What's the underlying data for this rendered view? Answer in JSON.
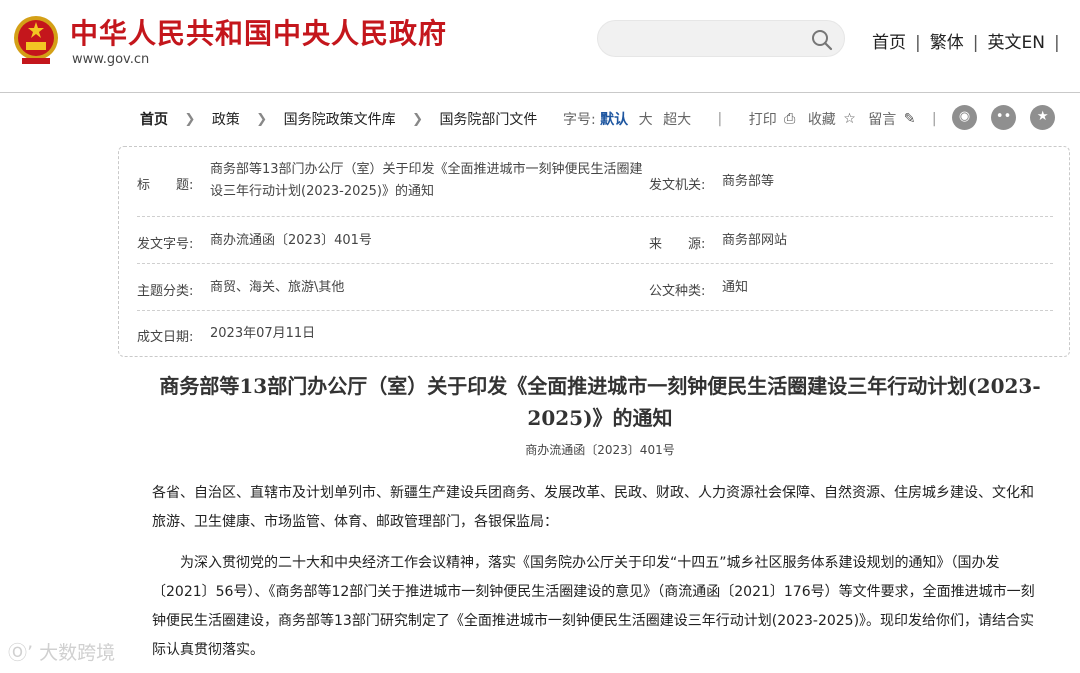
{
  "header": {
    "site_title": "中华人民共和国中央人民政府",
    "site_url": "www.gov.cn",
    "search_placeholder": "",
    "links": [
      "首页",
      "繁体",
      "英文EN"
    ],
    "separator": "|"
  },
  "breadcrumb": [
    "首页",
    "政策",
    "国务院政策文件库",
    "国务院部门文件"
  ],
  "toolbar": {
    "font_size_label": "字号:",
    "font_default": "默认",
    "font_large": "大",
    "font_xlarge": "超大",
    "print_label": "打印",
    "favorite_label": "收藏",
    "comment_label": "留言"
  },
  "share_icons": [
    "weibo-icon",
    "wechat-icon",
    "star-icon"
  ],
  "info": {
    "title_label": "标　　题:",
    "title_value": "商务部等13部门办公厅（室）关于印发《全面推进城市一刻钟便民生活圈建设三年行动计划(2023-2025)》的通知",
    "issuer_label": "发文机关:",
    "issuer_value": "商务部等",
    "doc_no_label": "发文字号:",
    "doc_no_value": "商办流通函〔2023〕401号",
    "source_label": "来　　源:",
    "source_value": "商务部网站",
    "topic_label": "主题分类:",
    "topic_value": "商贸、海关、旅游\\其他",
    "type_label": "公文种类:",
    "type_value": "通知",
    "date_label": "成文日期:",
    "date_value": "2023年07月11日"
  },
  "article": {
    "title": "商务部等13部门办公厅（室）关于印发《全面推进城市一刻钟便民生活圈建设三年行动计划(2023-2025)》的通知",
    "number": "商办流通函〔2023〕401号",
    "addressees": "各省、自治区、直辖市及计划单列市、新疆生产建设兵团商务、发展改革、民政、财政、人力资源社会保障、自然资源、住房城乡建设、文化和旅游、卫生健康、市场监管、体育、邮政管理部门，各银保监局：",
    "body": "为深入贯彻党的二十大和中央经济工作会议精神，落实《国务院办公厅关于印发“十四五”城乡社区服务体系建设规划的通知》（国办发〔2021〕56号）、《商务部等12部门关于推进城市一刻钟便民生活圈建设的意见》（商流通函〔2021〕176号）等文件要求，全面推进城市一刻钟便民生活圈建设，商务部等13部门研究制定了《全面推进城市一刻钟便民生活圈建设三年行动计划(2023-2025)》。现印发给你们，请结合实际认真贯彻落实。"
  },
  "watermark": "大数跨境",
  "colors": {
    "brand_red": "#c4161c",
    "active_blue": "#1e56a0",
    "icon_gray": "#8f8f8f"
  }
}
